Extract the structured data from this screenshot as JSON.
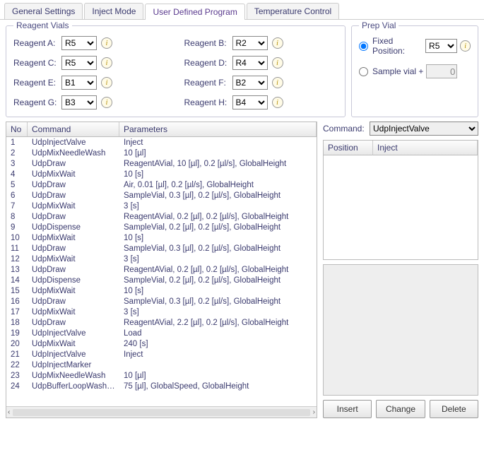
{
  "tabs": [
    {
      "label": "General Settings",
      "active": false
    },
    {
      "label": "Inject Mode",
      "active": false
    },
    {
      "label": "User Defined Program",
      "active": true
    },
    {
      "label": "Temperature Control",
      "active": false
    }
  ],
  "reagent_box": {
    "title": "Reagent Vials",
    "items": [
      {
        "label": "Reagent A:",
        "value": "R5"
      },
      {
        "label": "Reagent B:",
        "value": "R2"
      },
      {
        "label": "Reagent C:",
        "value": "R5"
      },
      {
        "label": "Reagent D:",
        "value": "R4"
      },
      {
        "label": "Reagent E:",
        "value": "B1"
      },
      {
        "label": "Reagent F:",
        "value": "B2"
      },
      {
        "label": "Reagent G:",
        "value": "B3"
      },
      {
        "label": "Reagent H:",
        "value": "B4"
      }
    ]
  },
  "prep_box": {
    "title": "Prep Vial",
    "fixed_label": "Fixed Position:",
    "fixed_value": "R5",
    "sample_label": "Sample vial +",
    "sample_value": "0",
    "selected": "fixed"
  },
  "table": {
    "headers": {
      "no": "No",
      "command": "Command",
      "params": "Parameters"
    },
    "rows": [
      {
        "no": "1",
        "cmd": "UdpInjectValve",
        "params": "Inject"
      },
      {
        "no": "2",
        "cmd": "UdpMixNeedleWash",
        "params": "10 [µl]"
      },
      {
        "no": "3",
        "cmd": "UdpDraw",
        "params": "ReagentAVial, 10 [µl], 0.2 [µl/s], GlobalHeight"
      },
      {
        "no": "4",
        "cmd": "UdpMixWait",
        "params": "10 [s]"
      },
      {
        "no": "5",
        "cmd": "UdpDraw",
        "params": "Air, 0.01 [µl], 0.2 [µl/s], GlobalHeight"
      },
      {
        "no": "6",
        "cmd": "UdpDraw",
        "params": "SampleVial, 0.3 [µl], 0.2 [µl/s], GlobalHeight"
      },
      {
        "no": "7",
        "cmd": "UdpMixWait",
        "params": "3 [s]"
      },
      {
        "no": "8",
        "cmd": "UdpDraw",
        "params": "ReagentAVial, 0.2 [µl], 0.2 [µl/s], GlobalHeight"
      },
      {
        "no": "9",
        "cmd": "UdpDispense",
        "params": "SampleVial, 0.2 [µl], 0.2 [µl/s], GlobalHeight"
      },
      {
        "no": "10",
        "cmd": "UdpMixWait",
        "params": "10 [s]"
      },
      {
        "no": "11",
        "cmd": "UdpDraw",
        "params": "SampleVial, 0.3 [µl], 0.2 [µl/s], GlobalHeight"
      },
      {
        "no": "12",
        "cmd": "UdpMixWait",
        "params": "3 [s]"
      },
      {
        "no": "13",
        "cmd": "UdpDraw",
        "params": "ReagentAVial, 0.2 [µl], 0.2 [µl/s], GlobalHeight"
      },
      {
        "no": "14",
        "cmd": "UdpDispense",
        "params": "SampleVial, 0.2 [µl], 0.2 [µl/s], GlobalHeight"
      },
      {
        "no": "15",
        "cmd": "UdpMixWait",
        "params": "10 [s]"
      },
      {
        "no": "16",
        "cmd": "UdpDraw",
        "params": "SampleVial, 0.3 [µl], 0.2 [µl/s], GlobalHeight"
      },
      {
        "no": "17",
        "cmd": "UdpMixWait",
        "params": "3 [s]"
      },
      {
        "no": "18",
        "cmd": "UdpDraw",
        "params": "ReagentAVial, 2.2 [µl], 0.2 [µl/s], GlobalHeight"
      },
      {
        "no": "19",
        "cmd": "UdpInjectValve",
        "params": "Load"
      },
      {
        "no": "20",
        "cmd": "UdpMixWait",
        "params": "240 [s]"
      },
      {
        "no": "21",
        "cmd": "UdpInjectValve",
        "params": "Inject"
      },
      {
        "no": "22",
        "cmd": "UdpInjectMarker",
        "params": ""
      },
      {
        "no": "23",
        "cmd": "UdpMixNeedleWash",
        "params": "10 [µl]"
      },
      {
        "no": "24",
        "cmd": "UdpBufferLoopWashAf...",
        "params": "75 [µl], GlobalSpeed, GlobalHeight"
      }
    ]
  },
  "right": {
    "command_label": "Command:",
    "command_value": "UdpInjectValve",
    "param_headers": {
      "pos": "Position",
      "val": "Inject"
    },
    "buttons": {
      "insert": "Insert",
      "change": "Change",
      "delete": "Delete"
    }
  },
  "hscroll": {
    "left": "‹",
    "right": "›"
  }
}
